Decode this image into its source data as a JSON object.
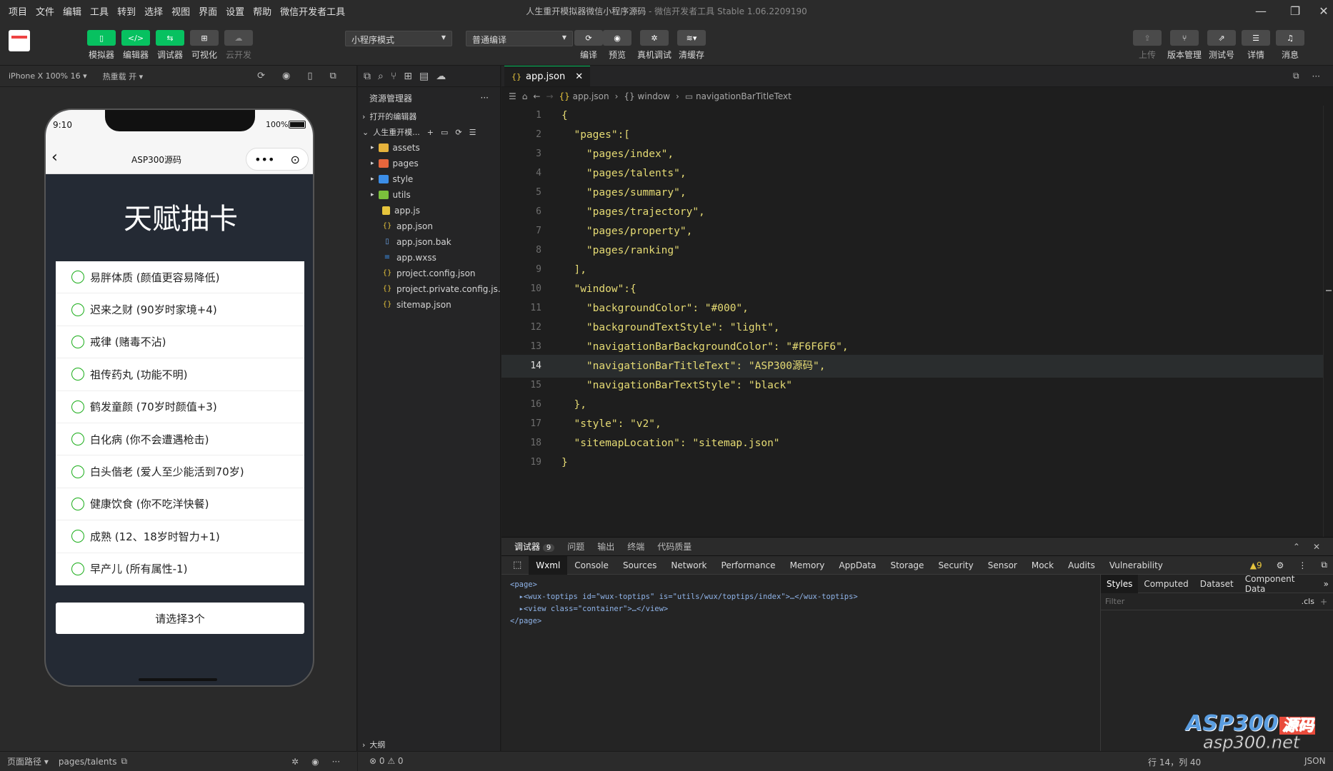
{
  "menu": [
    "项目",
    "文件",
    "编辑",
    "工具",
    "转到",
    "选择",
    "视图",
    "界面",
    "设置",
    "帮助",
    "微信开发者工具"
  ],
  "window_title": "人生重开模拟器微信小程序源码",
  "window_subtitle": "- 微信开发者工具 Stable 1.06.2209190",
  "toolbar": {
    "left_buttons": [
      "模拟器",
      "编辑器",
      "调试器",
      "可视化",
      "云开发"
    ],
    "mode_select": "小程序模式",
    "compile_select": "普通编译",
    "mid_buttons": [
      "编译",
      "预览",
      "真机调试",
      "清缓存"
    ],
    "right_buttons": [
      "上传",
      "版本管理",
      "测试号",
      "详情",
      "消息"
    ]
  },
  "simulator": {
    "device": "iPhone X 100% 16 ▾",
    "hotreload": "热重载 开 ▾",
    "time": "9:10",
    "battery": "100%",
    "nav_title": "ASP300源码",
    "page_heading": "天赋抽卡",
    "talents": [
      "易胖体质 (颜值更容易降低)",
      "迟来之财 (90岁时家境+4)",
      "戒律 (赌毒不沾)",
      "祖传药丸 (功能不明)",
      "鹤发童颜 (70岁时颜值+3)",
      "白化病 (你不会遭遇枪击)",
      "白头偕老 (爱人至少能活到70岁)",
      "健康饮食 (你不吃洋快餐)",
      "成熟 (12、18岁时智力+1)",
      "早产儿 (所有属性-1)"
    ],
    "select_button": "请选择3个",
    "footer_path_label": "页面路径 ▾",
    "footer_path": "pages/talents"
  },
  "explorer": {
    "title": "资源管理器",
    "open_editors": "打开的编辑器",
    "project": "人生重开模...",
    "folders": [
      "assets",
      "pages",
      "style",
      "utils"
    ],
    "files": [
      "app.js",
      "app.json",
      "app.json.bak",
      "app.wxss",
      "project.config.json",
      "project.private.config.js...",
      "sitemap.json"
    ],
    "outline": "大纲",
    "problems": "⊗ 0 ⚠ 0"
  },
  "editor": {
    "tab": "app.json",
    "breadcrumb": [
      "app.json",
      "window",
      "navigationBarTitleText"
    ],
    "lines": [
      {
        "n": "1",
        "t": "{"
      },
      {
        "n": "2",
        "t": "  \"pages\":["
      },
      {
        "n": "3",
        "t": "    \"pages/index\","
      },
      {
        "n": "4",
        "t": "    \"pages/talents\","
      },
      {
        "n": "5",
        "t": "    \"pages/summary\","
      },
      {
        "n": "6",
        "t": "    \"pages/trajectory\","
      },
      {
        "n": "7",
        "t": "    \"pages/property\","
      },
      {
        "n": "8",
        "t": "    \"pages/ranking\""
      },
      {
        "n": "9",
        "t": "  ],"
      },
      {
        "n": "10",
        "t": "  \"window\":{"
      },
      {
        "n": "11",
        "t": "    \"backgroundColor\": \"#000\","
      },
      {
        "n": "12",
        "t": "    \"backgroundTextStyle\": \"light\","
      },
      {
        "n": "13",
        "t": "    \"navigationBarBackgroundColor\": \"#F6F6F6\","
      },
      {
        "n": "14",
        "t": "    \"navigationBarTitleText\": \"ASP300源码\","
      },
      {
        "n": "15",
        "t": "    \"navigationBarTextStyle\": \"black\""
      },
      {
        "n": "16",
        "t": "  },"
      },
      {
        "n": "17",
        "t": "  \"style\": \"v2\","
      },
      {
        "n": "18",
        "t": "  \"sitemapLocation\": \"sitemap.json\""
      },
      {
        "n": "19",
        "t": "}"
      }
    ]
  },
  "devtools": {
    "top_tabs": [
      "调试器",
      "问题",
      "输出",
      "终端",
      "代码质量"
    ],
    "badge": "9",
    "tabs": [
      "Wxml",
      "Console",
      "Sources",
      "Network",
      "Performance",
      "Memory",
      "AppData",
      "Storage",
      "Security",
      "Sensor",
      "Mock",
      "Audits",
      "Vulnerability"
    ],
    "warn_count": "▲9",
    "dom": [
      "<page>",
      "  ▸<wux-toptips id=\"wux-toptips\" is=\"utils/wux/toptips/index\">…</wux-toptips>",
      "  ▸<view class=\"container\">…</view>",
      "</page>"
    ],
    "style_tabs": [
      "Styles",
      "Computed",
      "Dataset",
      "Component Data"
    ],
    "filter_placeholder": "Filter",
    "cls": ".cls"
  },
  "statusbar": {
    "position": "行 14，列 40",
    "lang": "JSON"
  },
  "watermark": "ASP300源码 asp300.net"
}
